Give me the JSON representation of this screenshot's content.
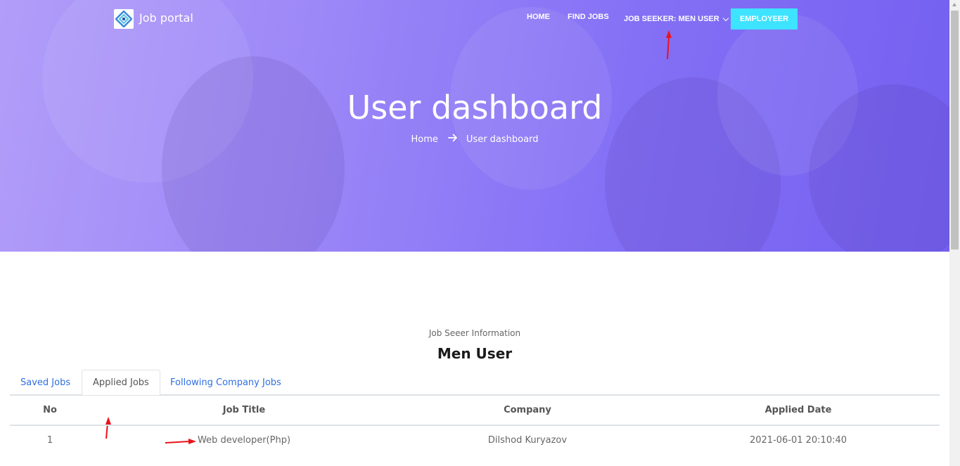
{
  "nav": {
    "logo_text": "Job portal",
    "items": [
      {
        "label": "HOME"
      },
      {
        "label": "FIND JOBS"
      },
      {
        "label": "JOB SEEKER: MEN USER"
      }
    ],
    "employer_button": "EMPLOYEER"
  },
  "hero": {
    "title": "User dashboard",
    "breadcrumb": {
      "home": "Home",
      "current": "User dashboard"
    }
  },
  "profile": {
    "label": "Job Seeer Information",
    "name": "Men User"
  },
  "tabs": [
    {
      "label": "Saved Jobs",
      "active": false
    },
    {
      "label": "Applied Jobs",
      "active": true
    },
    {
      "label": "Following Company Jobs",
      "active": false
    }
  ],
  "table": {
    "headers": [
      "No",
      "Job Title",
      "Company",
      "Applied Date"
    ],
    "rows": [
      [
        "1",
        "Web developer(Php)",
        "Dilshod Kuryazov",
        "2021-06-01 20:10:40"
      ]
    ]
  },
  "colors": {
    "hero_gradient": [
      "#b29df9",
      "#7460f0"
    ],
    "employer_button": "#3ee3ff",
    "tab_link": "#2f6fe0",
    "annotation": "#e8141b"
  }
}
